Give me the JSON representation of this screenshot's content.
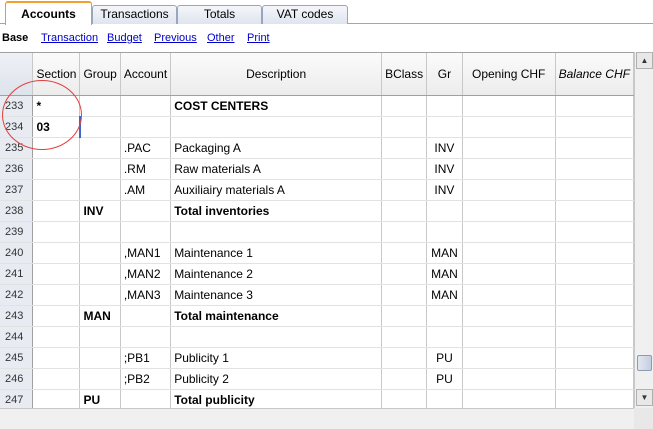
{
  "tabs": [
    {
      "label": "Accounts",
      "active": true
    },
    {
      "label": "Transactions",
      "active": false
    },
    {
      "label": "Totals",
      "active": false
    },
    {
      "label": "VAT codes",
      "active": false
    }
  ],
  "views": {
    "current": "Base",
    "links": [
      "Transaction",
      "Budget",
      "Previous",
      "Other",
      "Print"
    ]
  },
  "columns": [
    "",
    "Section",
    "Group",
    "Account",
    "Description",
    "BClass",
    "Gr",
    "Opening CHF",
    "Balance CHF"
  ],
  "rows": [
    {
      "n": "233",
      "section": "*",
      "group": "",
      "account": "",
      "desc": "COST CENTERS",
      "bclass": "",
      "gr": "",
      "opening": "",
      "balance": "",
      "bold": true
    },
    {
      "n": "234",
      "section": "03",
      "group": "",
      "account": "",
      "desc": "",
      "bclass": "",
      "gr": "",
      "opening": "",
      "balance": "",
      "bold": true
    },
    {
      "n": "235",
      "section": "",
      "group": "",
      "account": ".PAC",
      "desc": "Packaging A",
      "bclass": "",
      "gr": "INV",
      "opening": "",
      "balance": "",
      "bold": false
    },
    {
      "n": "236",
      "section": "",
      "group": "",
      "account": ".RM",
      "desc": "Raw materials A",
      "bclass": "",
      "gr": "INV",
      "opening": "",
      "balance": "",
      "bold": false
    },
    {
      "n": "237",
      "section": "",
      "group": "",
      "account": ".AM",
      "desc": "Auxiliairy materials A",
      "bclass": "",
      "gr": "INV",
      "opening": "",
      "balance": "",
      "bold": false
    },
    {
      "n": "238",
      "section": "",
      "group": "INV",
      "account": "",
      "desc": "Total inventories",
      "bclass": "",
      "gr": "",
      "opening": "",
      "balance": "",
      "bold": true
    },
    {
      "n": "239",
      "section": "",
      "group": "",
      "account": "",
      "desc": "",
      "bclass": "",
      "gr": "",
      "opening": "",
      "balance": "",
      "bold": false
    },
    {
      "n": "240",
      "section": "",
      "group": "",
      "account": ",MAN1",
      "desc": "Maintenance 1",
      "bclass": "",
      "gr": "MAN",
      "opening": "",
      "balance": "",
      "bold": false
    },
    {
      "n": "241",
      "section": "",
      "group": "",
      "account": ",MAN2",
      "desc": "Maintenance 2",
      "bclass": "",
      "gr": "MAN",
      "opening": "",
      "balance": "",
      "bold": false
    },
    {
      "n": "242",
      "section": "",
      "group": "",
      "account": ",MAN3",
      "desc": "Maintenance 3",
      "bclass": "",
      "gr": "MAN",
      "opening": "",
      "balance": "",
      "bold": false
    },
    {
      "n": "243",
      "section": "",
      "group": "MAN",
      "account": "",
      "desc": "Total maintenance",
      "bclass": "",
      "gr": "",
      "opening": "",
      "balance": "",
      "bold": true
    },
    {
      "n": "244",
      "section": "",
      "group": "",
      "account": "",
      "desc": "",
      "bclass": "",
      "gr": "",
      "opening": "",
      "balance": "",
      "bold": false
    },
    {
      "n": "245",
      "section": "",
      "group": "",
      "account": ";PB1",
      "desc": "Publicity 1",
      "bclass": "",
      "gr": "PU",
      "opening": "",
      "balance": "",
      "bold": false
    },
    {
      "n": "246",
      "section": "",
      "group": "",
      "account": ";PB2",
      "desc": "Publicity 2",
      "bclass": "",
      "gr": "PU",
      "opening": "",
      "balance": "",
      "bold": false
    },
    {
      "n": "247",
      "section": "",
      "group": "PU",
      "account": "",
      "desc": "Total publicity",
      "bclass": "",
      "gr": "",
      "opening": "",
      "balance": "",
      "bold": true
    }
  ],
  "icons": {
    "scroll_up": "arrow-up-icon",
    "scroll_down": "arrow-down-icon"
  },
  "colors": {
    "active_tab_accent": "#f0a030",
    "link": "#0000cc",
    "annotation_circle": "#e04040"
  }
}
